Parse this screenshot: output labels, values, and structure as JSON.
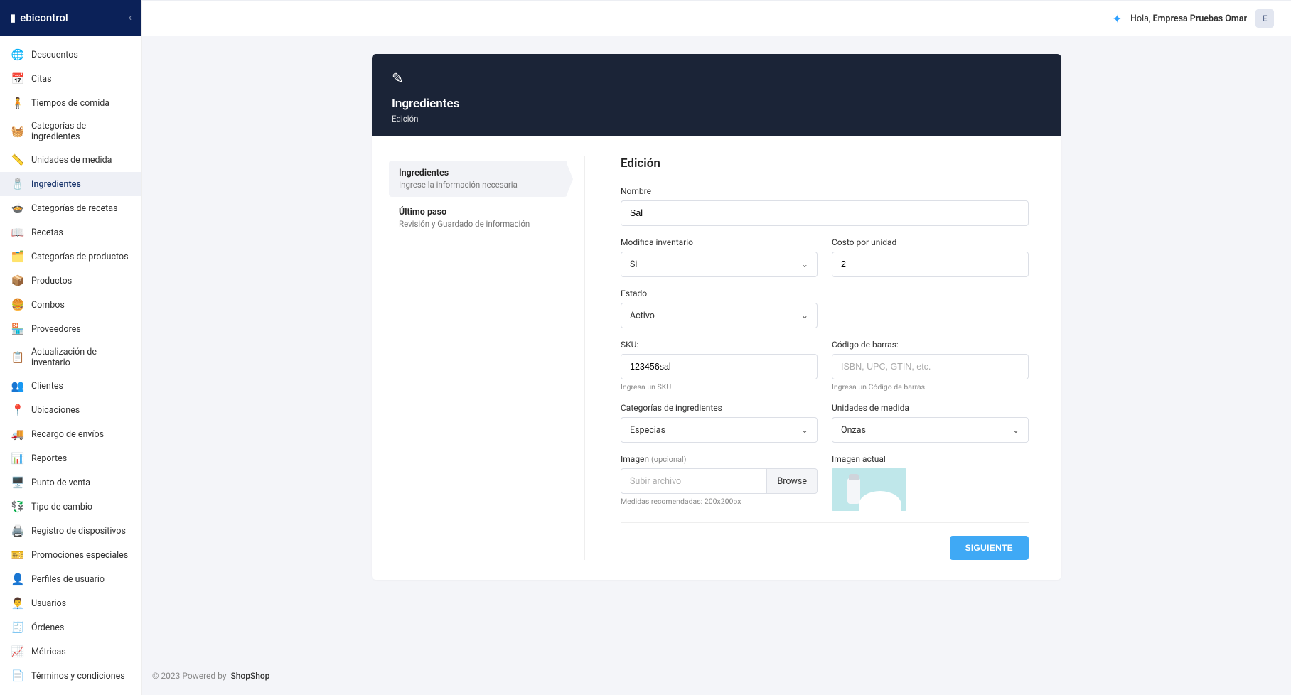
{
  "brand": {
    "name": "ebicontrol"
  },
  "topbar": {
    "greeting_prefix": "Hola,",
    "user_name": "Empresa Pruebas Omar",
    "avatar_initial": "E"
  },
  "sidebar": {
    "items": [
      {
        "label": "Descuentos",
        "icon": "🌐"
      },
      {
        "label": "Citas",
        "icon": "📅"
      },
      {
        "label": "Tiempos de comida",
        "icon": "🧍"
      },
      {
        "label": "Categorías de ingredientes",
        "icon": "🧺"
      },
      {
        "label": "Unidades de medida",
        "icon": "📏"
      },
      {
        "label": "Ingredientes",
        "icon": "🧂",
        "active": true
      },
      {
        "label": "Categorías de recetas",
        "icon": "🍲"
      },
      {
        "label": "Recetas",
        "icon": "📖"
      },
      {
        "label": "Categorías de productos",
        "icon": "🗂️"
      },
      {
        "label": "Productos",
        "icon": "📦"
      },
      {
        "label": "Combos",
        "icon": "🍔"
      },
      {
        "label": "Proveedores",
        "icon": "🏪"
      },
      {
        "label": "Actualización de inventario",
        "icon": "📋"
      },
      {
        "label": "Clientes",
        "icon": "👥"
      },
      {
        "label": "Ubicaciones",
        "icon": "📍"
      },
      {
        "label": "Recargo de envíos",
        "icon": "🚚"
      },
      {
        "label": "Reportes",
        "icon": "📊"
      },
      {
        "label": "Punto de venta",
        "icon": "🖥️"
      },
      {
        "label": "Tipo de cambio",
        "icon": "💱"
      },
      {
        "label": "Registro de dispositivos",
        "icon": "🖨️"
      },
      {
        "label": "Promociones especiales",
        "icon": "🎫"
      },
      {
        "label": "Perfiles de usuario",
        "icon": "👤"
      },
      {
        "label": "Usuarios",
        "icon": "👨‍💼"
      },
      {
        "label": "Órdenes",
        "icon": "🧾"
      },
      {
        "label": "Métricas",
        "icon": "📈"
      },
      {
        "label": "Términos y condiciones",
        "icon": "📄"
      }
    ]
  },
  "header": {
    "title": "Ingredientes",
    "subtitle": "Edición"
  },
  "steps": [
    {
      "title": "Ingredientes",
      "desc": "Ingrese la información necesaria",
      "active": true
    },
    {
      "title": "Último paso",
      "desc": "Revisión y Guardado de información",
      "active": false
    }
  ],
  "form": {
    "title": "Edición",
    "nombre_label": "Nombre",
    "nombre_value": "Sal",
    "modifica_label": "Modifica inventario",
    "modifica_value": "Si",
    "costo_label": "Costo por unidad",
    "costo_value": "2",
    "estado_label": "Estado",
    "estado_value": "Activo",
    "sku_label": "SKU:",
    "sku_value": "123456sal",
    "sku_hint": "Ingresa un SKU",
    "barcode_label": "Código de barras:",
    "barcode_placeholder": "ISBN, UPC, GTIN, etc.",
    "barcode_hint": "Ingresa un Código de barras",
    "cat_label": "Categorías de ingredientes",
    "cat_value": "Especias",
    "unit_label": "Unidades de medida",
    "unit_value": "Onzas",
    "img_label": "Imagen",
    "img_opt": "(opcional)",
    "img_placeholder": "Subir archivo",
    "img_browse": "Browse",
    "img_hint": "Medidas recomendadas: 200x200px",
    "img_current_label": "Imagen actual",
    "next_btn": "SIGUIENTE"
  },
  "footer": {
    "copyright": "© 2023 Powered by",
    "powered": "ShopShop"
  }
}
